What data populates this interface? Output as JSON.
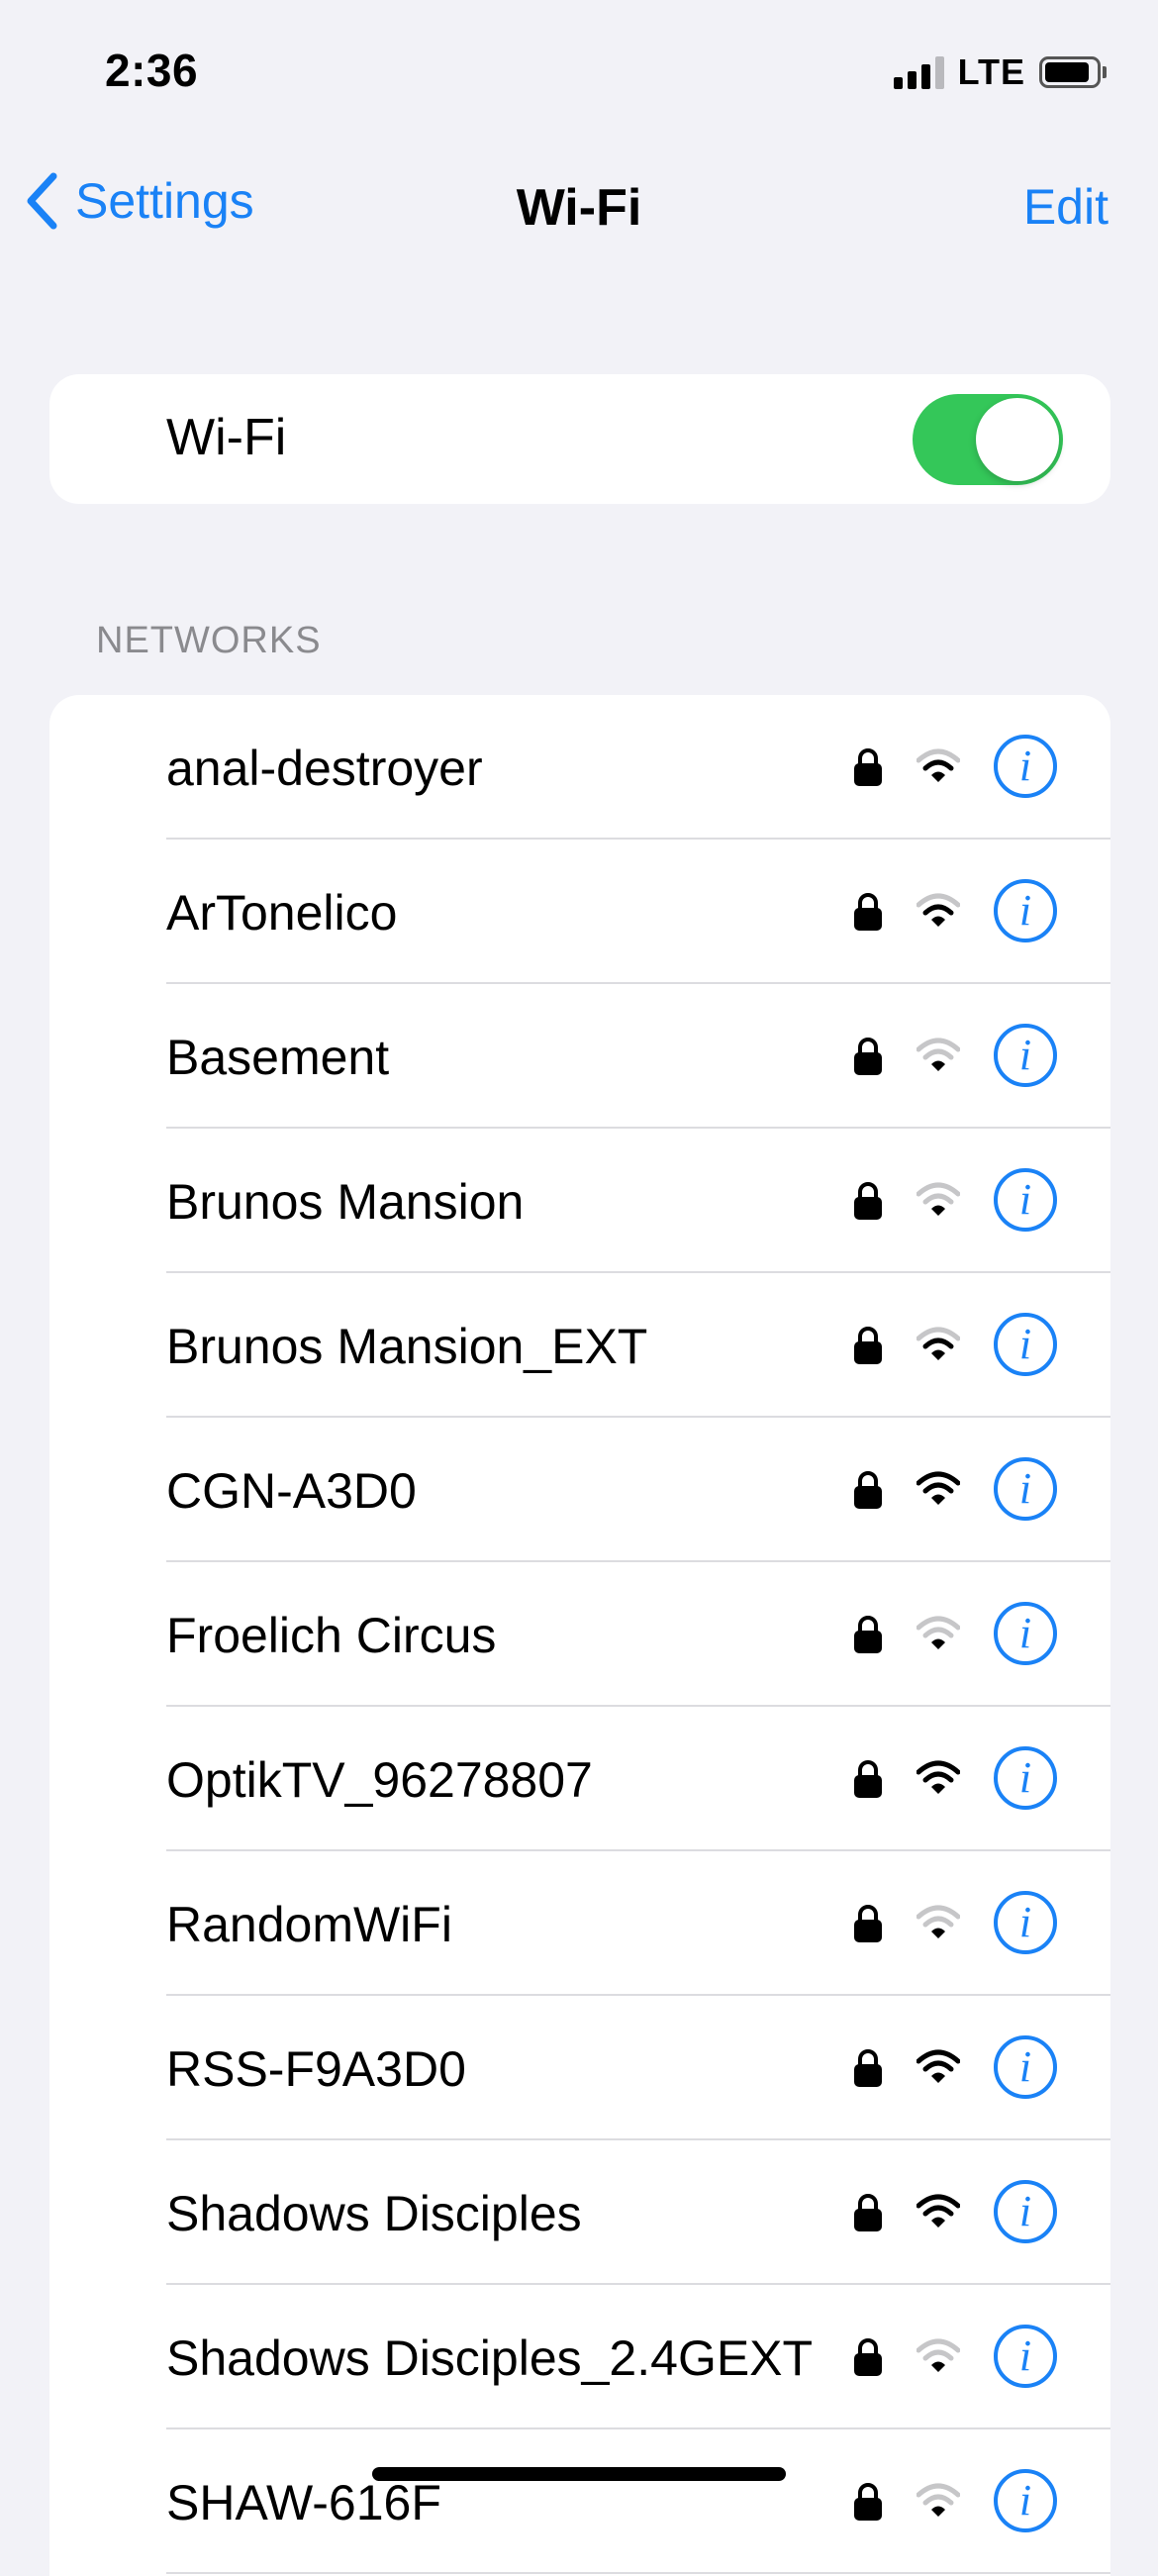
{
  "status_bar": {
    "time": "2:36",
    "network_type": "LTE",
    "signal_bars": 3,
    "signal_total": 4
  },
  "nav": {
    "back_label": "Settings",
    "title": "Wi-Fi",
    "edit_label": "Edit"
  },
  "wifi_toggle": {
    "label": "Wi-Fi",
    "on": true,
    "color": "#34c759"
  },
  "networks_header": "NETWORKS",
  "networks": [
    {
      "name": "anal-destroyer",
      "secured": true,
      "signal": 2
    },
    {
      "name": "ArTonelico",
      "secured": true,
      "signal": 2
    },
    {
      "name": "Basement",
      "secured": true,
      "signal": 1
    },
    {
      "name": "Brunos Mansion",
      "secured": true,
      "signal": 1
    },
    {
      "name": "Brunos Mansion_EXT",
      "secured": true,
      "signal": 2
    },
    {
      "name": "CGN-A3D0",
      "secured": true,
      "signal": 3
    },
    {
      "name": "Froelich Circus",
      "secured": true,
      "signal": 1
    },
    {
      "name": "OptikTV_96278807",
      "secured": true,
      "signal": 3
    },
    {
      "name": "RandomWiFi",
      "secured": true,
      "signal": 1
    },
    {
      "name": "RSS-F9A3D0",
      "secured": true,
      "signal": 3
    },
    {
      "name": "Shadows Disciples",
      "secured": true,
      "signal": 3
    },
    {
      "name": "Shadows Disciples_2.4GEXT",
      "secured": true,
      "signal": 1
    },
    {
      "name": "SHAW-616F",
      "secured": true,
      "signal": 1
    }
  ],
  "colors": {
    "accent": "#1a82f6",
    "background": "#f2f2f7",
    "toggle_on": "#34c759"
  },
  "icons": {
    "back": "chevron-left-icon",
    "lock": "lock-icon",
    "wifi": "wifi-signal-icon",
    "info": "info-icon"
  },
  "info_glyph": "i"
}
